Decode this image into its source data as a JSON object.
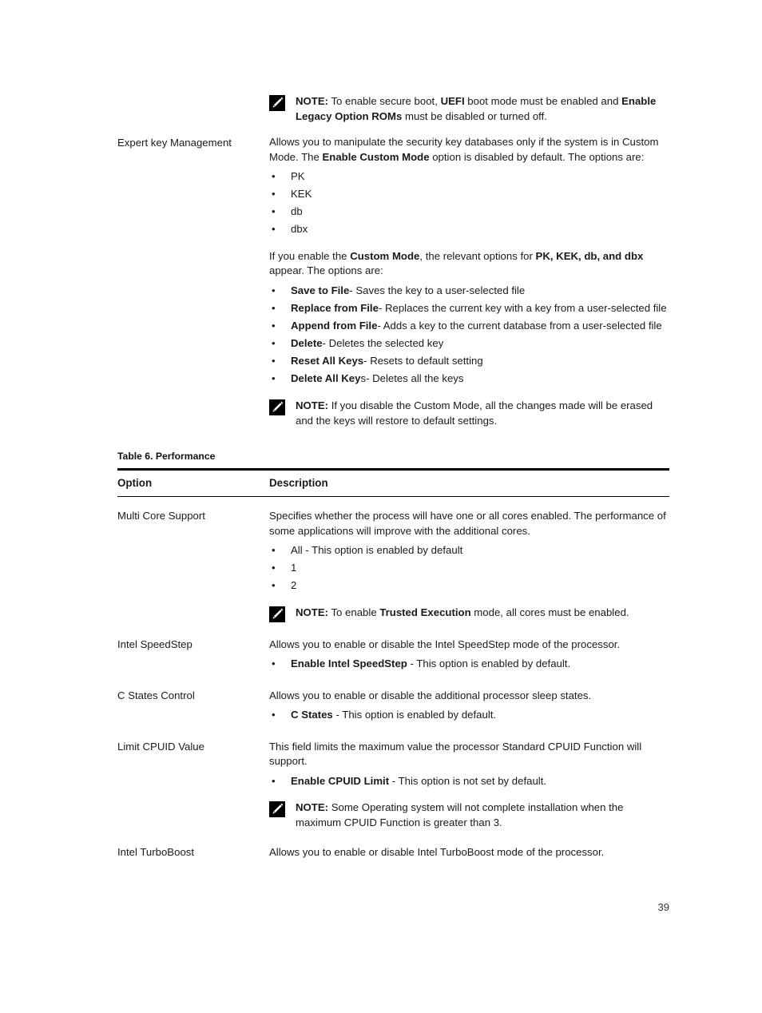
{
  "page": {
    "number": "39",
    "background": "#ffffff",
    "text_color": "#1a1a1a"
  },
  "icons": {
    "note_icon_name": "note-pencil-icon"
  },
  "top_note": {
    "label": "NOTE:",
    "part1": " To enable secure boot, ",
    "bold1": "UEFI",
    "part2": " boot mode must be enabled and ",
    "bold2": "Enable Legacy Option ROMs",
    "part3": " must be disabled or turned off."
  },
  "expert_key_management": {
    "option": "Expert key Management",
    "desc_part1": "Allows you to manipulate the security key databases only if the system is in Custom Mode. The ",
    "desc_bold1": "Enable Custom Mode",
    "desc_part2": " option is disabled by default. The options are:",
    "options_list": [
      "PK",
      "KEK",
      "db",
      "dbx"
    ],
    "custom_mode_part1": "If you enable the ",
    "custom_mode_bold1": "Custom Mode",
    "custom_mode_part2": ", the relevant options for ",
    "custom_mode_bold2": "PK, KEK, db, and dbx",
    "custom_mode_part3": " appear. The options are:",
    "actions": [
      {
        "bold": "Save to File",
        "rest": "- Saves the key to a user-selected file"
      },
      {
        "bold": "Replace from File",
        "rest": "- Replaces the current key with a key from a user-selected file"
      },
      {
        "bold": "Append from File",
        "rest": "- Adds a key to the current database from a user-selected file"
      },
      {
        "bold": "Delete",
        "rest": "- Deletes the selected key"
      },
      {
        "bold": "Reset All Keys",
        "rest": "- Resets to default setting"
      },
      {
        "bold": "Delete All Key",
        "rest": "s- Deletes all the keys"
      }
    ],
    "bottom_note": {
      "label": "NOTE:",
      "text": " If you disable the Custom Mode, all the changes made will be erased and the keys will restore to default settings."
    }
  },
  "table": {
    "caption": "Table 6. Performance",
    "headers": {
      "option": "Option",
      "description": "Description"
    },
    "rows": [
      {
        "option": "Multi Core Support",
        "desc": "Specifies whether the process will have one or all cores enabled. The performance of some applications will improve with the additional cores.",
        "bullets": [
          {
            "bold": "",
            "rest": "All - This option is enabled by default"
          },
          {
            "bold": "",
            "rest": "1"
          },
          {
            "bold": "",
            "rest": "2"
          }
        ],
        "note": {
          "label": "NOTE:",
          "part1": " To enable ",
          "bold1": "Trusted Execution",
          "part2": " mode, all cores must be enabled."
        }
      },
      {
        "option": "Intel SpeedStep",
        "desc": "Allows you to enable or disable the Intel SpeedStep mode of the processor.",
        "bullets": [
          {
            "bold": "Enable Intel SpeedStep",
            "rest": " - This option is enabled by default."
          }
        ]
      },
      {
        "option": "C States Control",
        "desc": "Allows you to enable or disable the additional processor sleep states.",
        "bullets": [
          {
            "bold": "C States",
            "rest": " - This option is enabled by default."
          }
        ]
      },
      {
        "option": "Limit CPUID Value",
        "desc": "This field limits the maximum value the processor Standard CPUID Function will support.",
        "bullets": [
          {
            "bold": "Enable CPUID Limit",
            "rest": " - This option is not set by default."
          }
        ],
        "note": {
          "label": "NOTE:",
          "part1": " Some Operating system will not complete installation when the maximum CPUID Function is greater than 3.",
          "bold1": "",
          "part2": ""
        }
      },
      {
        "option": "Intel TurboBoost",
        "desc": "Allows you to enable or disable Intel TurboBoost mode of the processor.",
        "bullets": []
      }
    ]
  }
}
